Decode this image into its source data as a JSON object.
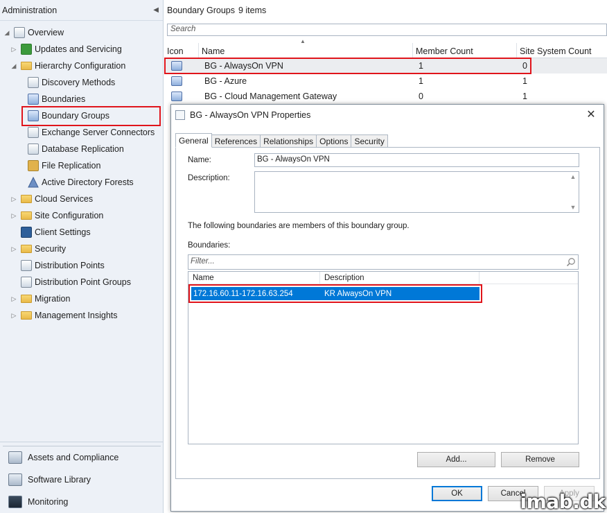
{
  "nav": {
    "header": "Administration",
    "items": [
      {
        "label": "Overview",
        "icon": "overview-icon"
      },
      {
        "label": "Updates and Servicing",
        "icon": "updates-icon"
      },
      {
        "label": "Hierarchy Configuration",
        "icon": "folder-icon"
      },
      {
        "label": "Discovery Methods",
        "icon": "discovery-icon"
      },
      {
        "label": "Boundaries",
        "icon": "boundaries-icon"
      },
      {
        "label": "Boundary Groups",
        "icon": "boundary-group-icon"
      },
      {
        "label": "Exchange Server Connectors",
        "icon": "exchange-icon"
      },
      {
        "label": "Database Replication",
        "icon": "database-icon"
      },
      {
        "label": "File Replication",
        "icon": "file-replication-icon"
      },
      {
        "label": "Active Directory Forests",
        "icon": "ad-forest-icon"
      },
      {
        "label": "Cloud Services",
        "icon": "folder-icon"
      },
      {
        "label": "Site Configuration",
        "icon": "folder-icon"
      },
      {
        "label": "Client Settings",
        "icon": "client-settings-icon"
      },
      {
        "label": "Security",
        "icon": "folder-icon"
      },
      {
        "label": "Distribution Points",
        "icon": "dp-icon"
      },
      {
        "label": "Distribution Point Groups",
        "icon": "dp-group-icon"
      },
      {
        "label": "Migration",
        "icon": "folder-icon"
      },
      {
        "label": "Management Insights",
        "icon": "folder-icon"
      }
    ],
    "workspaces": [
      {
        "label": "Assets and Compliance",
        "icon": "assets-icon"
      },
      {
        "label": "Software Library",
        "icon": "library-icon"
      },
      {
        "label": "Monitoring",
        "icon": "monitoring-icon"
      }
    ]
  },
  "main": {
    "title": "Boundary Groups",
    "count": "9 items",
    "search_placeholder": "Search",
    "columns": [
      "Icon",
      "Name",
      "Member Count",
      "Site System Count"
    ],
    "rows": [
      {
        "name": "BG - AlwaysOn VPN",
        "member_count": "1",
        "site_system_count": "0"
      },
      {
        "name": "BG - Azure",
        "member_count": "1",
        "site_system_count": "1"
      },
      {
        "name": "BG - Cloud Management Gateway",
        "member_count": "0",
        "site_system_count": "1"
      }
    ]
  },
  "dialog": {
    "title": "BG - AlwaysOn VPN Properties",
    "close": "✕",
    "tabs": [
      "General",
      "References",
      "Relationships",
      "Options",
      "Security"
    ],
    "name_label": "Name:",
    "name_value": "BG - AlwaysOn VPN",
    "description_label": "Description:",
    "description_value": "",
    "members_text": "The following boundaries are members of this boundary group.",
    "boundaries_label": "Boundaries:",
    "filter_placeholder": "Filter...",
    "boundary_columns": [
      "Name",
      "Description"
    ],
    "boundaries": [
      {
        "name": "172.16.60.11-172.16.63.254",
        "description": "KR AlwaysOn VPN"
      }
    ],
    "add_label": "Add...",
    "remove_label": "Remove",
    "ok_label": "OK",
    "cancel_label": "Cancel",
    "apply_label": "Apply"
  },
  "watermark": "imab.dk",
  "colors": {
    "highlight": "#e0141b",
    "selection": "#0078d7"
  }
}
